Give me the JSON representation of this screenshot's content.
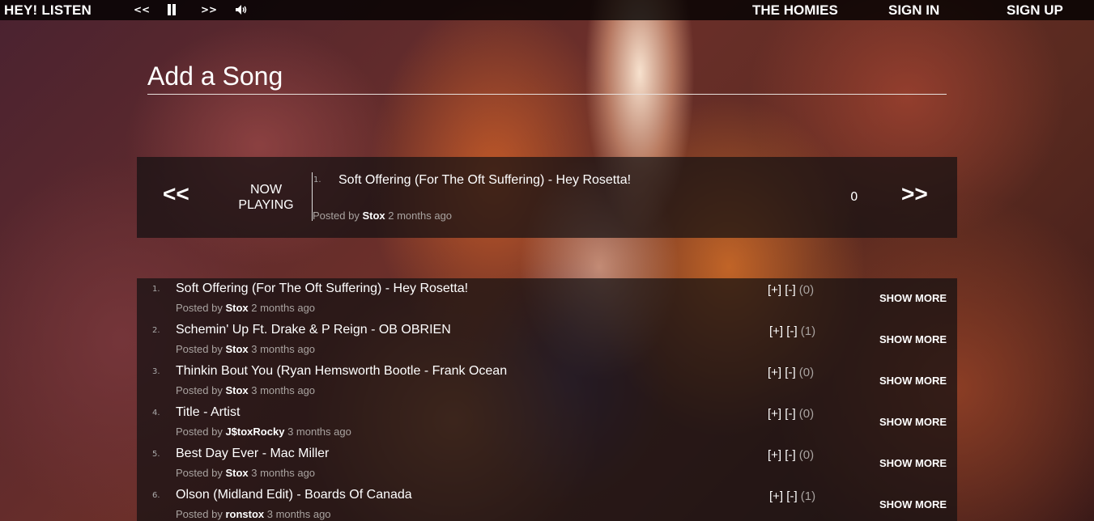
{
  "topbar": {
    "brand": "HEY! LISTEN",
    "prev": "<<",
    "pause_icon": "pause-icon",
    "next": ">>",
    "volume_icon": "speaker-icon",
    "volume_glyph": "🔊",
    "links": [
      "THE HOMIES",
      "SIGN IN",
      "SIGN UP"
    ]
  },
  "add_song": {
    "placeholder": "Add a Song"
  },
  "now_playing": {
    "prev": "<<",
    "next": ">>",
    "label": "NOW PLAYING",
    "number": "1.",
    "title": "Soft Offering (For The Oft Suffering) - Hey Rosetta!",
    "posted_prefix": "Posted by",
    "user": "Stox",
    "time": "2 months ago",
    "score": "0"
  },
  "songs": [
    {
      "number": "1.",
      "title": "Soft Offering (For The Oft Suffering) - Hey Rosetta!",
      "posted_prefix": "Posted by",
      "user": "Stox",
      "time": "2 months ago",
      "up": "[+]",
      "down": "[-]",
      "count": "(0)",
      "more": "SHOW MORE"
    },
    {
      "number": "2.",
      "title": "Schemin' Up Ft. Drake & P Reign - OB OBRIEN",
      "posted_prefix": "Posted by",
      "user": "Stox",
      "time": "3 months ago",
      "up": "[+]",
      "down": "[-]",
      "count": "(1)",
      "more": "SHOW MORE"
    },
    {
      "number": "3.",
      "title": "Thinkin Bout You (Ryan Hemsworth Bootle - Frank Ocean",
      "posted_prefix": "Posted by",
      "user": "Stox",
      "time": "3 months ago",
      "up": "[+]",
      "down": "[-]",
      "count": "(0)",
      "more": "SHOW MORE"
    },
    {
      "number": "4.",
      "title": "Title - Artist",
      "posted_prefix": "Posted by",
      "user": "J$toxRocky",
      "time": "3 months ago",
      "up": "[+]",
      "down": "[-]",
      "count": "(0)",
      "more": "SHOW MORE"
    },
    {
      "number": "5.",
      "title": "Best Day Ever - Mac Miller",
      "posted_prefix": "Posted by",
      "user": "Stox",
      "time": "3 months ago",
      "up": "[+]",
      "down": "[-]",
      "count": "(0)",
      "more": "SHOW MORE"
    },
    {
      "number": "6.",
      "title": "Olson (Midland Edit) - Boards Of Canada",
      "posted_prefix": "Posted by",
      "user": "ronstox",
      "time": "3 months ago",
      "up": "[+]",
      "down": "[-]",
      "count": "(1)",
      "more": "SHOW MORE"
    }
  ]
}
